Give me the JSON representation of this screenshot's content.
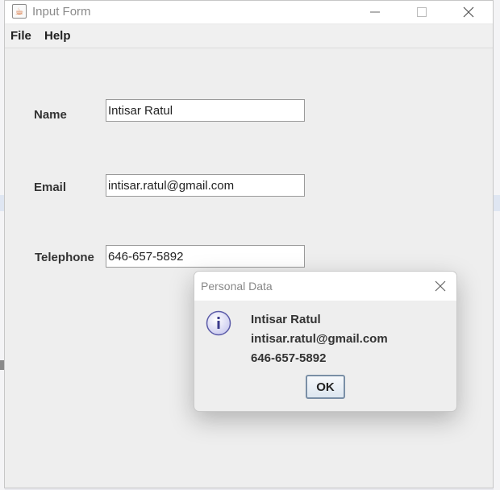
{
  "window": {
    "title": "Input Form",
    "icon": "java-app-icon"
  },
  "menu": {
    "items": [
      "File",
      "Help"
    ]
  },
  "form": {
    "name_label": "Name",
    "name_value": "Intisar Ratul",
    "email_label": "Email",
    "email_value": "intisar.ratul@gmail.com",
    "telephone_label": "Telephone",
    "telephone_value": "646-657-5892"
  },
  "dialog": {
    "title": "Personal Data",
    "icon": "info-icon",
    "lines": [
      "Intisar Ratul",
      "intisar.ratul@gmail.com",
      "646-657-5892"
    ],
    "ok_label": "OK"
  },
  "colors": {
    "window_bg": "#eeeeee",
    "titlebar_bg": "#ffffff",
    "button_border": "#7a8fa6"
  }
}
